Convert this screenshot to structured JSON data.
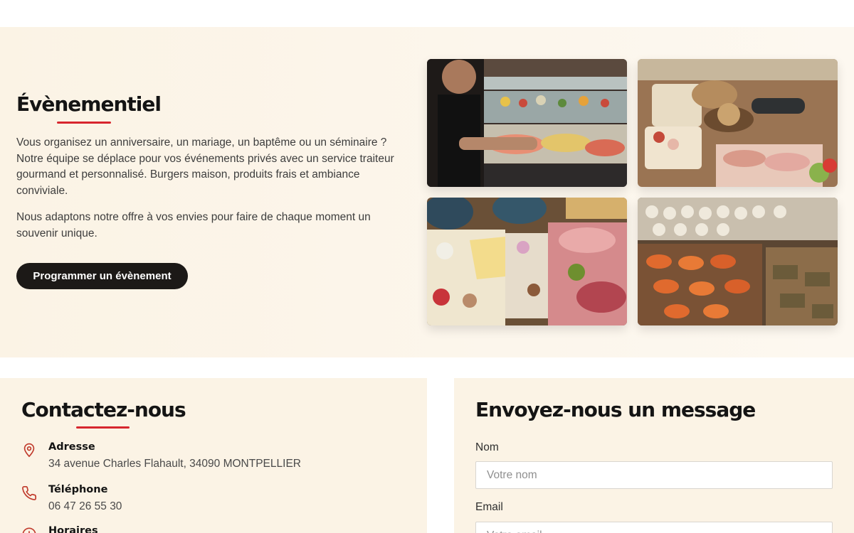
{
  "event": {
    "title": "Évènementiel",
    "paragraph_1": "Vous organisez un anniversaire, un mariage, un baptême ou un séminaire ? Notre équipe se déplace pour vos événements privés avec un service traiteur gourmand et personnalisé. Burgers maison, produits frais et ambiance conviviale.",
    "paragraph_2": "Nous adaptons notre offre à vos envies pour faire de chaque moment un souvenir unique.",
    "cta_label": "Programmer un évènement",
    "accent_color": "#d7262e",
    "button_color": "#1c1917"
  },
  "contact": {
    "title": "Contactez-nous",
    "items": [
      {
        "icon": "map-pin-icon",
        "label": "Adresse",
        "value": "34 avenue Charles Flahault, 34090 MONTPELLIER"
      },
      {
        "icon": "phone-icon",
        "label": "Téléphone",
        "value": "06 47 26 55 30"
      },
      {
        "icon": "clock-icon",
        "label": "Horaires",
        "value": ""
      }
    ]
  },
  "message_form": {
    "title": "Envoyez-nous un message",
    "name_label": "Nom",
    "name_placeholder": "Votre nom",
    "email_label": "Email",
    "email_placeholder": "Votre email"
  }
}
